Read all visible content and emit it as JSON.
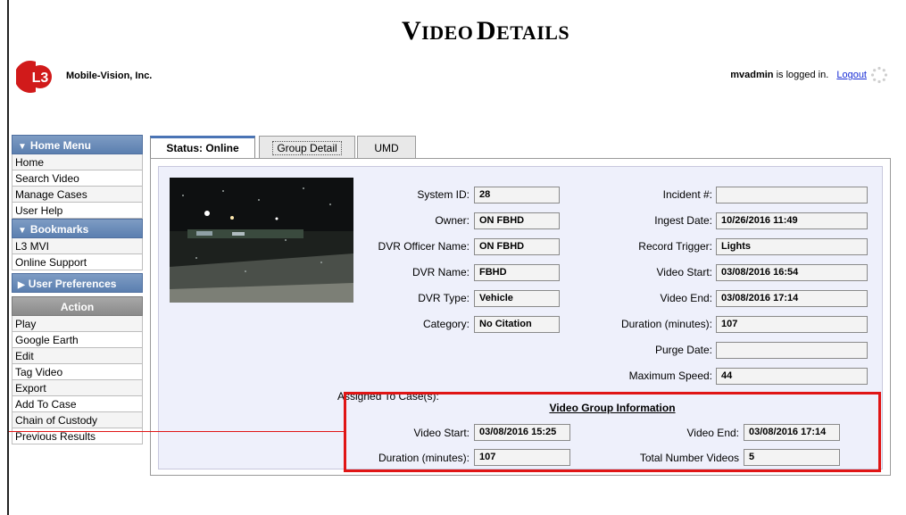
{
  "header": {
    "title_first_large": "V",
    "title_first_small": "IDEO",
    "title_second_large": "D",
    "title_second_small": "ETAILS",
    "company": "Mobile-Vision, Inc.",
    "username": "mvadmin",
    "logged_in_text": " is logged in.",
    "logout_label": "Logout",
    "logo_text": "L3"
  },
  "sidebar": {
    "home_menu": {
      "label": "Home Menu",
      "items": [
        "Home",
        "Search Video",
        "Manage Cases",
        "User Help"
      ]
    },
    "bookmarks": {
      "label": "Bookmarks",
      "items": [
        "L3 MVI",
        "Online Support"
      ]
    },
    "user_prefs": {
      "label": "User Preferences"
    },
    "action": {
      "label": "Action",
      "items": [
        "Play",
        "Google Earth",
        "Edit",
        "Tag Video",
        "Export",
        "Add To Case",
        "Chain of Custody",
        "Previous Results"
      ]
    }
  },
  "tabs": [
    "Status: Online",
    "Group Detail",
    "UMD"
  ],
  "details": {
    "system_id": {
      "label": "System ID:",
      "value": "28"
    },
    "owner": {
      "label": "Owner:",
      "value": "ON FBHD"
    },
    "dvr_officer": {
      "label": "DVR Officer Name:",
      "value": "ON FBHD"
    },
    "dvr_name": {
      "label": "DVR Name:",
      "value": "FBHD"
    },
    "dvr_type": {
      "label": "DVR Type:",
      "value": "Vehicle"
    },
    "category": {
      "label": "Category:",
      "value": "No Citation"
    },
    "incident": {
      "label": "Incident #:",
      "value": ""
    },
    "ingest_date": {
      "label": "Ingest Date:",
      "value": "10/26/2016 11:49"
    },
    "record_trigger": {
      "label": "Record Trigger:",
      "value": "Lights"
    },
    "video_start": {
      "label": "Video Start:",
      "value": "03/08/2016 16:54"
    },
    "video_end": {
      "label": "Video End:",
      "value": "03/08/2016 17:14"
    },
    "duration": {
      "label": "Duration (minutes):",
      "value": "107"
    },
    "purge_date": {
      "label": "Purge Date:",
      "value": ""
    },
    "max_speed": {
      "label": "Maximum Speed:",
      "value": "44"
    },
    "assigned_label": "Assigned To Case(s):"
  },
  "video_group": {
    "title": "Video Group Information",
    "start": {
      "label": "Video Start:",
      "value": "03/08/2016 15:25"
    },
    "end": {
      "label": "Video End:",
      "value": "03/08/2016 17:14"
    },
    "duration": {
      "label": "Duration (minutes):",
      "value": "107"
    },
    "total": {
      "label": "Total Number Videos",
      "value": "5"
    }
  },
  "colors": {
    "menu_blue": "#5b7fb0",
    "action_gray": "#8a8a8a",
    "highlight_red": "#e01515",
    "link_blue": "#1a2fd6"
  }
}
